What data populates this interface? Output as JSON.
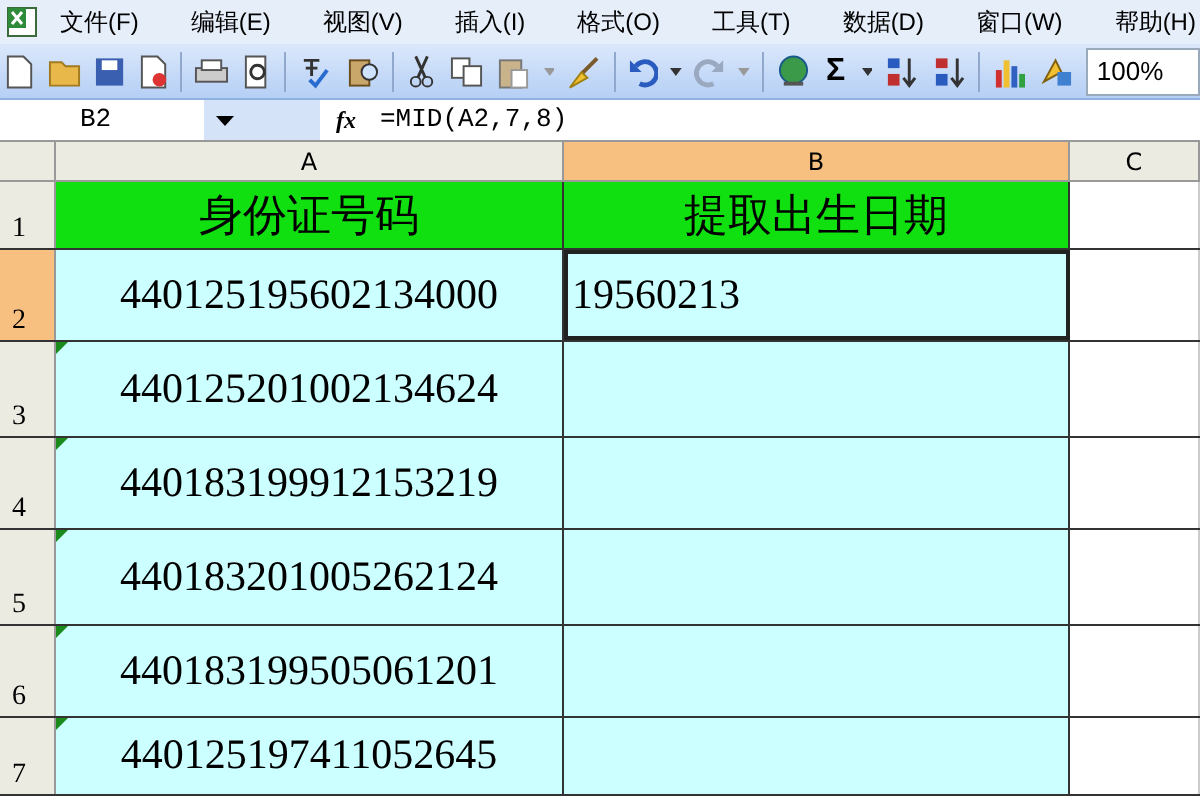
{
  "menu": [
    {
      "label": "文件(F)"
    },
    {
      "label": "编辑(E)"
    },
    {
      "label": "视图(V)"
    },
    {
      "label": "插入(I)"
    },
    {
      "label": "格式(O)"
    },
    {
      "label": "工具(T)"
    },
    {
      "label": "数据(D)"
    },
    {
      "label": "窗口(W)"
    },
    {
      "label": "帮助(H)"
    }
  ],
  "toolbar": {
    "autosum": "Σ",
    "zoom": "100%"
  },
  "formula_bar": {
    "name_box": "B2",
    "fx": "fx",
    "formula": "=MID(A2,7,8)"
  },
  "columns": [
    {
      "label": "A",
      "selected": false
    },
    {
      "label": "B",
      "selected": true
    },
    {
      "label": "C",
      "selected": false
    }
  ],
  "rows": [
    {
      "number": "1",
      "selected": false,
      "kind": "header",
      "cells": [
        {
          "text": "身份证号码",
          "active": false,
          "error_flag": false
        },
        {
          "text": "提取出生日期",
          "active": false,
          "error_flag": false
        }
      ]
    },
    {
      "number": "2",
      "selected": true,
      "kind": "data",
      "cells": [
        {
          "text": "440125195602134000",
          "active": false,
          "error_flag": false
        },
        {
          "text": "19560213",
          "active": true,
          "error_flag": false
        }
      ]
    },
    {
      "number": "3",
      "selected": false,
      "kind": "data",
      "cells": [
        {
          "text": "440125201002134624",
          "active": false,
          "error_flag": true
        },
        {
          "active": false,
          "error_flag": false
        }
      ]
    },
    {
      "number": "4",
      "selected": false,
      "kind": "data",
      "cells": [
        {
          "text": "440183199912153219",
          "active": false,
          "error_flag": true
        },
        {
          "active": false,
          "error_flag": false
        }
      ]
    },
    {
      "number": "5",
      "selected": false,
      "kind": "data",
      "cells": [
        {
          "text": "440183201005262124",
          "active": false,
          "error_flag": true
        },
        {
          "active": false,
          "error_flag": false
        }
      ]
    },
    {
      "number": "6",
      "selected": false,
      "kind": "data",
      "cells": [
        {
          "text": "440183199505061201",
          "active": false,
          "error_flag": true
        },
        {
          "active": false,
          "error_flag": false
        }
      ]
    },
    {
      "number": "7",
      "selected": false,
      "kind": "data",
      "cells": [
        {
          "text": "440125197411052645",
          "active": false,
          "error_flag": true
        },
        {
          "active": false,
          "error_flag": false
        }
      ]
    }
  ]
}
